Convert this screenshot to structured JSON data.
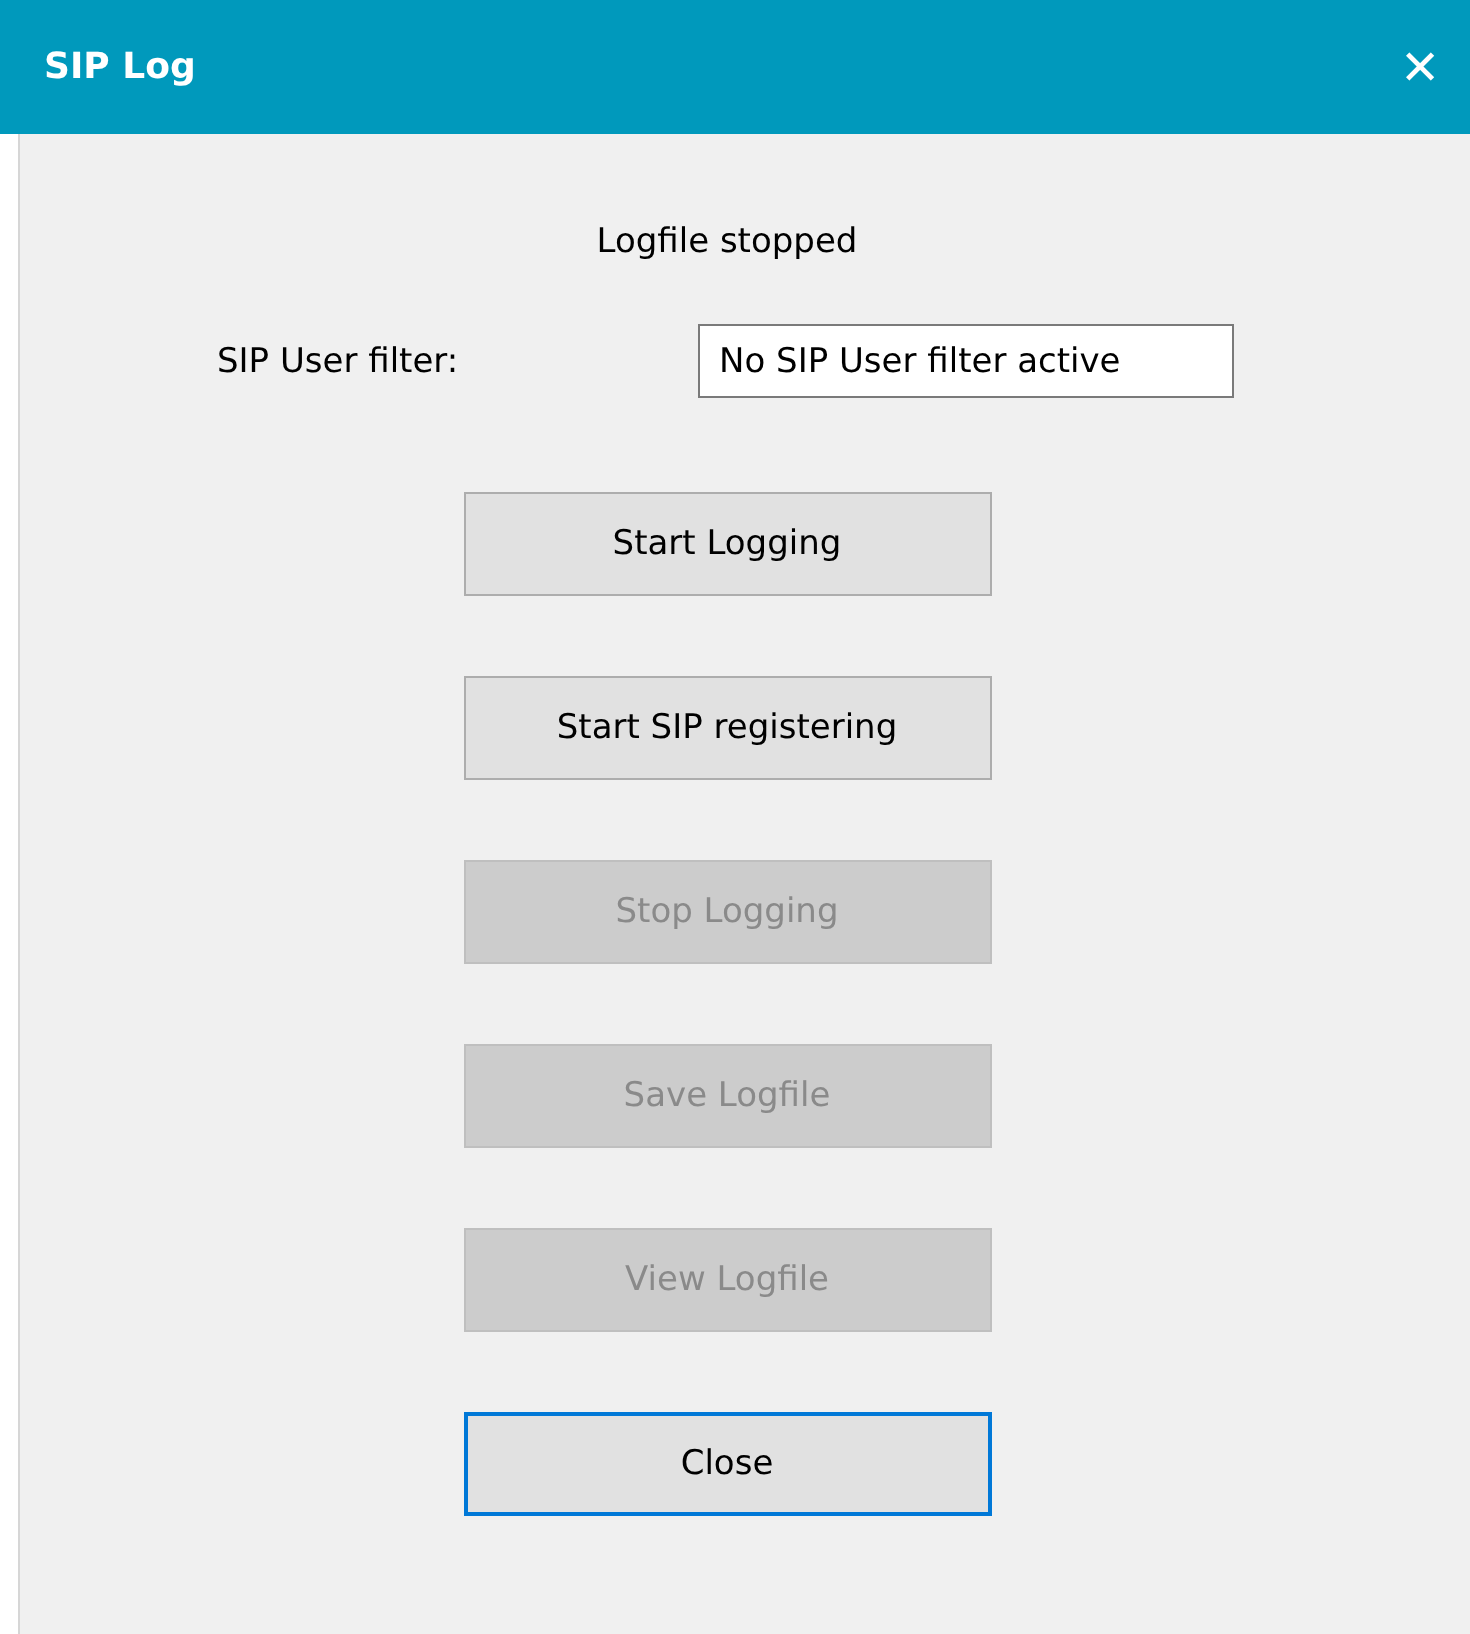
{
  "window": {
    "title": "SIP Log",
    "close": "✕"
  },
  "status": "Logfile stopped",
  "filter": {
    "label": "SIP User filter:",
    "value": "No SIP User filter active"
  },
  "buttons": [
    {
      "label": "Start Logging",
      "disabled": false,
      "focused": false
    },
    {
      "label": "Start SIP registering",
      "disabled": false,
      "focused": false
    },
    {
      "label": "Stop Logging",
      "disabled": true,
      "focused": false
    },
    {
      "label": "Save Logfile",
      "disabled": true,
      "focused": false
    },
    {
      "label": "View Logfile",
      "disabled": true,
      "focused": false
    },
    {
      "label": "Close",
      "disabled": false,
      "focused": true
    }
  ]
}
